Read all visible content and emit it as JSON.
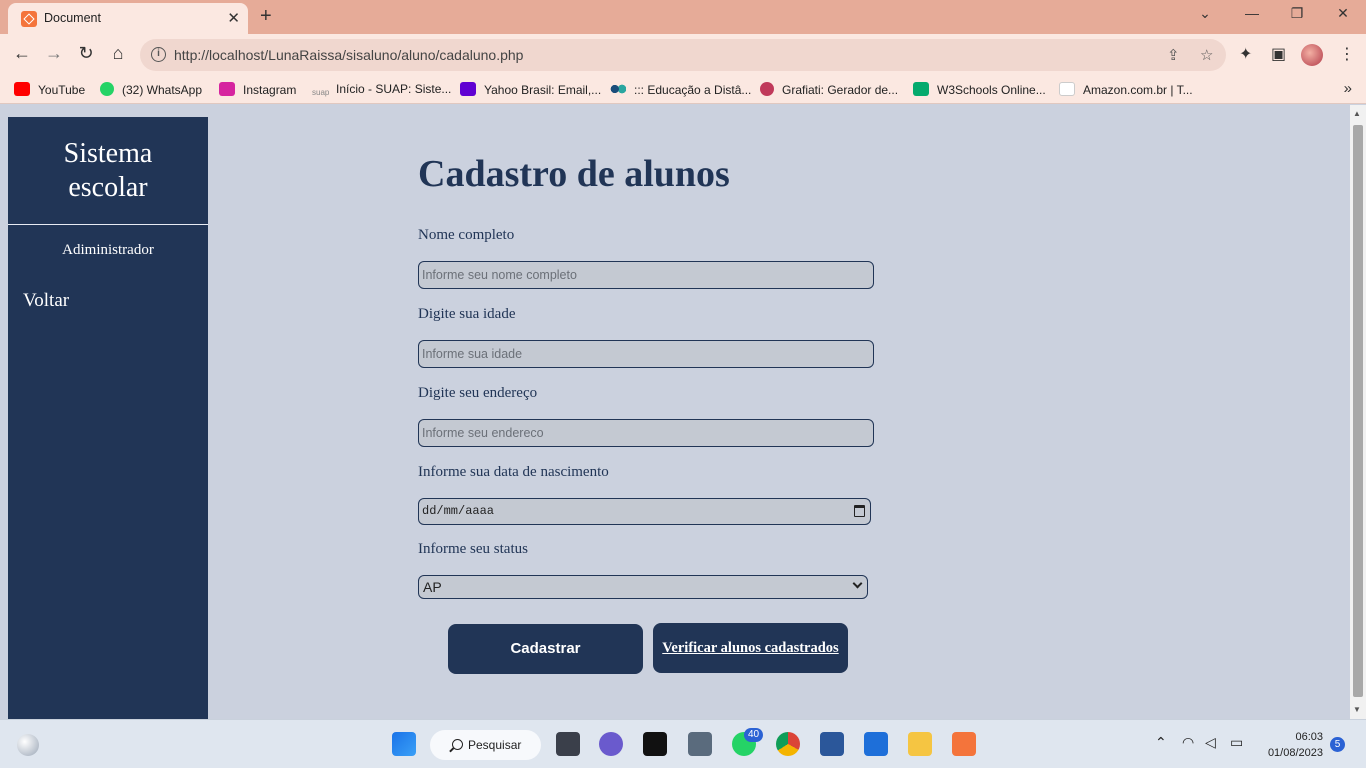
{
  "browser": {
    "tab_title": "Document",
    "url": "http://localhost/LunaRaissa/sisaluno/aluno/cadaluno.php",
    "bookmarks": [
      {
        "label": "YouTube",
        "icon": "youtube-icon",
        "color": "#ff0000"
      },
      {
        "label": "(32) WhatsApp",
        "icon": "whatsapp-icon",
        "color": "#25d366"
      },
      {
        "label": "Instagram",
        "icon": "instagram-icon",
        "color": "#d6249f"
      },
      {
        "label": "Início - SUAP: Siste...",
        "icon": "suap-icon",
        "color": "#888888"
      },
      {
        "label": "Yahoo Brasil: Email,...",
        "icon": "yahoo-icon",
        "color": "#6001d2"
      },
      {
        "label": "::: Educação a Distâ...",
        "icon": "ead-icon",
        "color": "#1a4d7a"
      },
      {
        "label": "Grafiati: Gerador de...",
        "icon": "grafiati-icon",
        "color": "#c0395a"
      },
      {
        "label": "W3Schools Online...",
        "icon": "w3schools-icon",
        "color": "#04aa6d"
      },
      {
        "label": "Amazon.com.br | T...",
        "icon": "amazon-icon",
        "color": "#222222"
      }
    ]
  },
  "sidebar": {
    "brand_line1": "Sistema",
    "brand_line2": "escolar",
    "admin": "Adiministrador",
    "back": "Voltar"
  },
  "form": {
    "title": "Cadastro de alunos",
    "name_label": "Nome completo",
    "name_placeholder": "Informe seu nome completo",
    "age_label": "Digite sua idade",
    "age_placeholder": "Informe sua idade",
    "address_label": "Digite seu endereço",
    "address_placeholder": "Informe seu endereco",
    "birth_label": "Informe sua data de nascimento",
    "birth_placeholder": "dd/mm/aaaa",
    "status_label": "Informe seu status",
    "status_value": "AP",
    "submit": "Cadastrar",
    "list_link": "Verificar alunos cadastrados"
  },
  "taskbar": {
    "search": "Pesquisar",
    "whatsapp_badge": "40",
    "time": "06:03",
    "date": "01/08/2023",
    "notifications": "5"
  },
  "colors": {
    "navy": "#213556",
    "page_bg": "#cbd1de",
    "chrome_tab": "#e6ab98"
  }
}
